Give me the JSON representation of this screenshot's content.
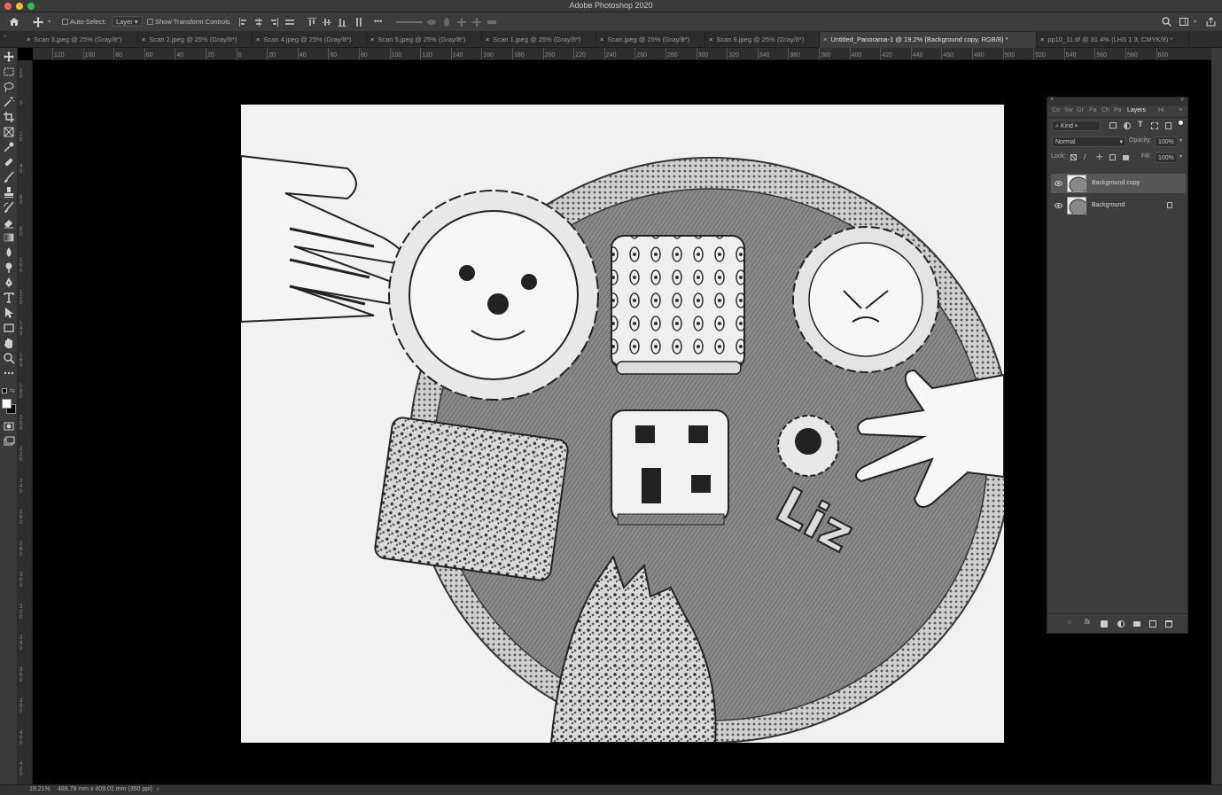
{
  "window": {
    "title": "Adobe Photoshop 2020"
  },
  "options_bar": {
    "auto_select_label": "Auto-Select:",
    "auto_select_value": "Layer",
    "transform_label": "Show Transform Controls",
    "more_label": "•••"
  },
  "tabs": [
    {
      "x": "×",
      "label": "Scan 3.jpeg @ 25% (Gray/8*)",
      "active": false
    },
    {
      "x": "×",
      "label": "Scan 2.jpeg @ 25% (Gray/8*)",
      "active": false
    },
    {
      "x": "×",
      "label": "Scan 4.jpeg @ 25% (Gray/8*)",
      "active": false
    },
    {
      "x": "×",
      "label": "Scan 5.jpeg @ 25% (Gray/8*)",
      "active": false
    },
    {
      "x": "×",
      "label": "Scan 1.jpeg @ 25% (Gray/8*)",
      "active": false
    },
    {
      "x": "×",
      "label": "Scan.jpeg @ 25% (Gray/8*)",
      "active": false
    },
    {
      "x": "×",
      "label": "Scan 6.jpeg @ 25% (Gray/8*)",
      "active": false
    },
    {
      "x": "×",
      "label": "Untitled_Panorama-1 @ 19.2% (Background copy, RGB/8) *",
      "active": true
    },
    {
      "x": "×",
      "label": "pp10_11.tif @ 31.4% (LHS 1 3, CMYK/8) *",
      "active": false
    }
  ],
  "ruler": {
    "h_ticks": [
      "120",
      "100",
      "80",
      "60",
      "40",
      "20",
      "0",
      "20",
      "40",
      "60",
      "80",
      "100",
      "120",
      "140",
      "160",
      "180",
      "200",
      "220",
      "240",
      "260",
      "280",
      "300",
      "320",
      "340",
      "360",
      "380",
      "400",
      "420",
      "440",
      "460",
      "480",
      "500",
      "520",
      "540",
      "560",
      "580",
      "600"
    ],
    "v_ticks": [
      "20",
      "0",
      "20",
      "40",
      "60",
      "80",
      "100",
      "120",
      "140",
      "160",
      "180",
      "200",
      "220",
      "240",
      "260",
      "280",
      "300",
      "320",
      "340",
      "360",
      "380",
      "400",
      "420"
    ]
  },
  "layers_panel": {
    "tabs": [
      "Co",
      "Sw",
      "Gr",
      "Pa",
      "Ch",
      "Pa",
      "Layers",
      "Hi"
    ],
    "kind_label": "Kind",
    "blend_mode": "Normal",
    "opacity_label": "Opacity:",
    "opacity_value": "100%",
    "lock_label": "Lock:",
    "fill_label": "Fill:",
    "fill_value": "100%",
    "layers": [
      {
        "name": "Background copy",
        "selected": true,
        "locked": false
      },
      {
        "name": "Background",
        "selected": false,
        "locked": true
      }
    ]
  },
  "canvas": {
    "lettering": "Liz"
  },
  "status_bar": {
    "zoom": "19.21%",
    "doc_size": "489.78 mm x 409.01 mm (350 ppi)"
  },
  "colors": {
    "foreground": "#ffffff",
    "background": "#000000",
    "panel": "#3d3d3d",
    "chrome": "#3a3a3a"
  }
}
